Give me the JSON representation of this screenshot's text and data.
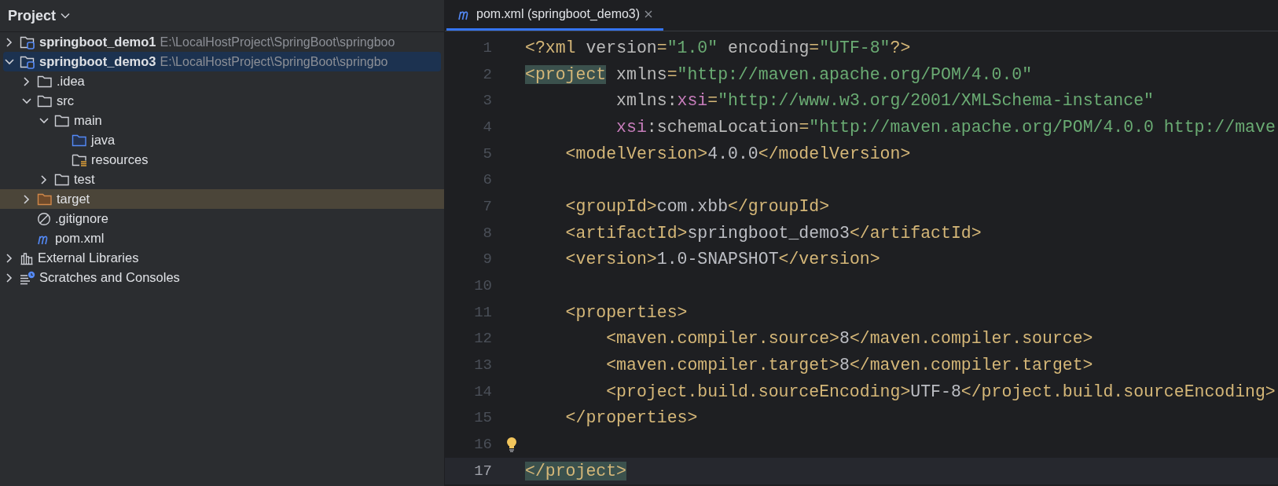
{
  "sidebar": {
    "title": "Project",
    "tree": [
      {
        "label": "springboot_demo1",
        "path": "E:\\LocalHostProject\\SpringBoot\\springboo",
        "kind": "module",
        "expanded": false,
        "selected": false
      },
      {
        "label": "springboot_demo3",
        "path": "E:\\LocalHostProject\\SpringBoot\\springbo",
        "kind": "module",
        "expanded": true,
        "selected": true,
        "children": [
          {
            "label": ".idea",
            "kind": "folder",
            "expanded": false,
            "selected": false
          },
          {
            "label": "src",
            "kind": "folder",
            "expanded": true,
            "selected": false,
            "children": [
              {
                "label": "main",
                "kind": "folder",
                "expanded": true,
                "selected": false,
                "children": [
                  {
                    "label": "java",
                    "kind": "source",
                    "selected": false
                  },
                  {
                    "label": "resources",
                    "kind": "resources",
                    "selected": false
                  }
                ]
              },
              {
                "label": "test",
                "kind": "folder",
                "expanded": false,
                "selected": false
              }
            ]
          },
          {
            "label": "target",
            "kind": "excluded",
            "expanded": false,
            "selected": false
          },
          {
            "label": ".gitignore",
            "kind": "ignore",
            "selected": false
          },
          {
            "label": "pom.xml",
            "kind": "maven",
            "selected": false
          }
        ]
      },
      {
        "label": "External Libraries",
        "kind": "libraries",
        "expanded": false,
        "selected": false
      },
      {
        "label": "Scratches and Consoles",
        "kind": "scratches",
        "expanded": false,
        "selected": false
      }
    ]
  },
  "editor": {
    "tabs": [
      {
        "label": "pom.xml (springboot_demo3)",
        "selected": true
      }
    ],
    "lines": [
      {
        "number": "1",
        "current": false,
        "tokens": [
          {
            "kind": "tag",
            "text": "<?xml "
          },
          {
            "kind": "attr",
            "text": "version"
          },
          {
            "kind": "tag",
            "text": "="
          },
          {
            "kind": "value",
            "text": "\"1.0\""
          },
          {
            "kind": "attr",
            "text": " encoding"
          },
          {
            "kind": "tag",
            "text": "="
          },
          {
            "kind": "value",
            "text": "\"UTF-8\""
          },
          {
            "kind": "tag",
            "text": "?>"
          }
        ]
      },
      {
        "number": "2",
        "current": false,
        "tokens": [
          {
            "kind": "match",
            "text": "<project"
          },
          {
            "kind": "attr",
            "text": " xmlns"
          },
          {
            "kind": "tag",
            "text": "="
          },
          {
            "kind": "value",
            "text": "\"http://maven.apache.org/POM/4.0.0\""
          }
        ]
      },
      {
        "number": "3",
        "current": false,
        "tokens": [
          {
            "kind": "attr",
            "text": "         xmlns:"
          },
          {
            "kind": "ns",
            "text": "xsi"
          },
          {
            "kind": "tag",
            "text": "="
          },
          {
            "kind": "value",
            "text": "\"http://www.w3.org/2001/XMLSchema-instance\""
          }
        ]
      },
      {
        "number": "4",
        "current": false,
        "tokens": [
          {
            "kind": "ns",
            "text": "         xsi"
          },
          {
            "kind": "attr",
            "text": ":schemaLocation"
          },
          {
            "kind": "tag",
            "text": "="
          },
          {
            "kind": "value",
            "text": "\"http://maven.apache.org/POM/4.0.0 http://mave"
          }
        ]
      },
      {
        "number": "5",
        "current": false,
        "tokens": [
          {
            "kind": "tag",
            "text": "    <modelVersion>"
          },
          {
            "kind": "text",
            "text": "4.0.0"
          },
          {
            "kind": "tag",
            "text": "</modelVersion>"
          }
        ]
      },
      {
        "number": "6",
        "current": false
      },
      {
        "number": "7",
        "current": false,
        "tokens": [
          {
            "kind": "tag",
            "text": "    <groupId>"
          },
          {
            "kind": "text",
            "text": "com.xbb"
          },
          {
            "kind": "tag",
            "text": "</groupId>"
          }
        ]
      },
      {
        "number": "8",
        "current": false,
        "tokens": [
          {
            "kind": "tag",
            "text": "    <artifactId>"
          },
          {
            "kind": "text",
            "text": "springboot_demo3"
          },
          {
            "kind": "tag",
            "text": "</artifactId>"
          }
        ]
      },
      {
        "number": "9",
        "current": false,
        "tokens": [
          {
            "kind": "tag",
            "text": "    <version>"
          },
          {
            "kind": "text",
            "text": "1.0-SNAPSHOT"
          },
          {
            "kind": "tag",
            "text": "</version>"
          }
        ]
      },
      {
        "number": "10",
        "current": false
      },
      {
        "number": "11",
        "current": false,
        "tokens": [
          {
            "kind": "tag",
            "text": "    <properties>"
          }
        ]
      },
      {
        "number": "12",
        "current": false,
        "tokens": [
          {
            "kind": "tag",
            "text": "        <maven.compiler.source>"
          },
          {
            "kind": "text",
            "text": "8"
          },
          {
            "kind": "tag",
            "text": "</maven.compiler.source>"
          }
        ]
      },
      {
        "number": "13",
        "current": false,
        "tokens": [
          {
            "kind": "tag",
            "text": "        <maven.compiler.target>"
          },
          {
            "kind": "text",
            "text": "8"
          },
          {
            "kind": "tag",
            "text": "</maven.compiler.target>"
          }
        ]
      },
      {
        "number": "14",
        "current": false,
        "tokens": [
          {
            "kind": "tag",
            "text": "        <project.build.sourceEncoding>"
          },
          {
            "kind": "text",
            "text": "UTF-8"
          },
          {
            "kind": "tag",
            "text": "</project.build.sourceEncoding>"
          }
        ]
      },
      {
        "number": "15",
        "current": false,
        "tokens": [
          {
            "kind": "tag",
            "text": "    </properties>"
          }
        ]
      },
      {
        "number": "16",
        "current": false,
        "bulb": true
      },
      {
        "number": "17",
        "current": true,
        "tokens": [
          {
            "kind": "match",
            "text": "</project>"
          }
        ]
      }
    ]
  }
}
